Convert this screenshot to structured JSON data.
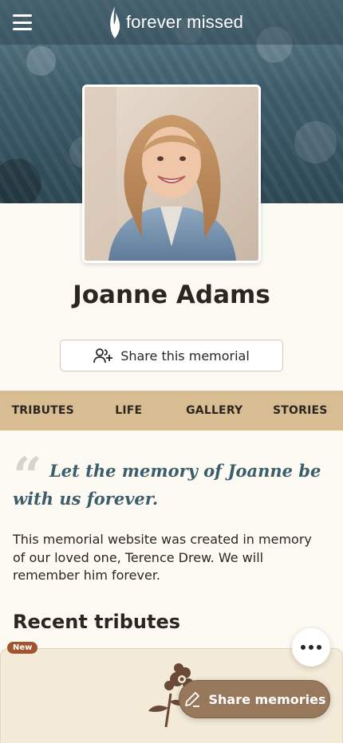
{
  "brand": {
    "name": "forever missed"
  },
  "memorial": {
    "name": "Joanne Adams",
    "share_label": "Share this memorial"
  },
  "tabs": [
    {
      "label": "TRIBUTES"
    },
    {
      "label": "LIFE"
    },
    {
      "label": "GALLERY"
    },
    {
      "label": "STORIES"
    }
  ],
  "quote": "Let the memory of Joanne be with us forever.",
  "intro": "This memorial website was created in memory of our loved one, Terence Drew. We will remember him forever.",
  "recent": {
    "title": "Recent tributes",
    "badge": "New"
  },
  "actions": {
    "share_memories_label": "Share memories"
  },
  "icons": {
    "menu": "menu-icon",
    "brand": "flame-icon",
    "share": "add-people-icon",
    "more": "more-horizontal-icon",
    "pen": "pen-icon",
    "flower": "flower-icon"
  },
  "colors": {
    "tabs_bg": "#d8bd93",
    "quote": "#3c5e6b",
    "fab": "#98785a",
    "badge": "#a1542e"
  }
}
